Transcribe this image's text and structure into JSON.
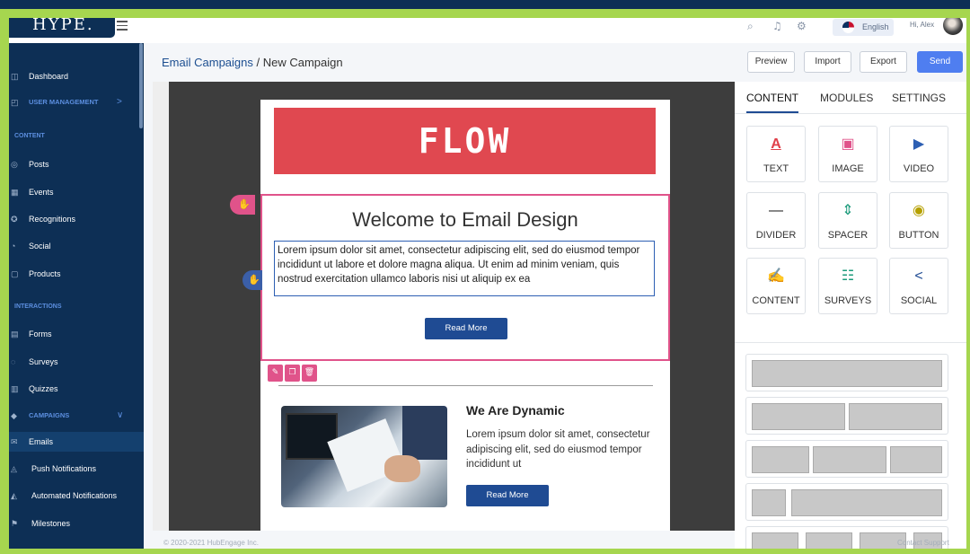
{
  "header": {
    "logo_text": "HYPE.",
    "language": "English",
    "greeting": "Hi, Alex"
  },
  "sidebar": {
    "items": [
      {
        "label": "Dashboard",
        "icon": "dashboard-icon"
      },
      {
        "label": "USER MANAGEMENT",
        "icon": "users-icon",
        "chevron": ">"
      },
      {
        "label": "Posts",
        "icon": "posts-icon"
      },
      {
        "label": "Events",
        "icon": "calendar-icon"
      },
      {
        "label": "Recognitions",
        "icon": "award-icon"
      },
      {
        "label": "Social",
        "icon": "social-icon"
      },
      {
        "label": "Products",
        "icon": "box-icon"
      },
      {
        "label": "Forms",
        "icon": "form-icon"
      },
      {
        "label": "Surveys",
        "icon": "survey-icon"
      },
      {
        "label": "Quizzes",
        "icon": "quiz-icon"
      },
      {
        "label": "CAMPAIGNS",
        "icon": "campaign-icon",
        "chevron": "∨"
      },
      {
        "label": "Emails",
        "icon": "mail-icon"
      },
      {
        "label": "Push Notifications",
        "icon": "bell-icon"
      },
      {
        "label": "Automated Notifications",
        "icon": "robot-icon"
      },
      {
        "label": "Milestones",
        "icon": "flag-icon"
      }
    ],
    "sections": {
      "content": "CONTENT",
      "interactions": "INTERACTIONS"
    }
  },
  "breadcrumb": {
    "parent": "Email Campaigns",
    "separator": " / ",
    "current": "New Campaign"
  },
  "toolbar": {
    "preview": "Preview",
    "import": "Import",
    "export": "Export",
    "send": "Send"
  },
  "email": {
    "hero_text": "FLOW",
    "welcome_title": "Welcome to Email Design",
    "welcome_body": "Lorem ipsum dolor sit amet, consectetur adipiscing elit, sed do eiusmod tempor incididunt ut labore et dolore magna aliqua. Ut enim ad minim veniam, quis nostrud exercitation ullamco laboris nisi ut aliquip ex ea",
    "read_more": "Read More",
    "dynamic_title": "We Are Dynamic",
    "dynamic_body": "Lorem ipsum dolor sit amet, consectetur adipiscing elit, sed do eiusmod tempor incididunt ut",
    "dynamic_button": "Read More"
  },
  "panel": {
    "tabs": [
      "CONTENT",
      "MODULES",
      "SETTINGS"
    ],
    "tiles": [
      {
        "label": "TEXT",
        "icon": "text-icon",
        "color": "#e0404a"
      },
      {
        "label": "IMAGE",
        "icon": "image-icon",
        "color": "#e0538a"
      },
      {
        "label": "VIDEO",
        "icon": "video-icon",
        "color": "#2d5fb3"
      },
      {
        "label": "DIVIDER",
        "icon": "divider-icon",
        "color": "#222222"
      },
      {
        "label": "SPACER",
        "icon": "spacer-icon",
        "color": "#1a9a7a"
      },
      {
        "label": "BUTTON",
        "icon": "button-icon",
        "color": "#b5a000"
      },
      {
        "label": "CONTENT",
        "icon": "html-icon",
        "color": "#8a4fc8"
      },
      {
        "label": "SURVEYS",
        "icon": "survey-icon",
        "color": "#1a9a7a"
      },
      {
        "label": "SOCIAL",
        "icon": "share-icon",
        "color": "#1f4b93"
      }
    ]
  },
  "footer": {
    "copyright": "© 2020-2021 HubEngage Inc.",
    "support": "Contact Support"
  },
  "colors": {
    "sidebar": "#0d2f55",
    "accent": "#1f4b93",
    "selection": "#e0538a",
    "send": "#4f7ef0",
    "hero": "#e04850"
  }
}
